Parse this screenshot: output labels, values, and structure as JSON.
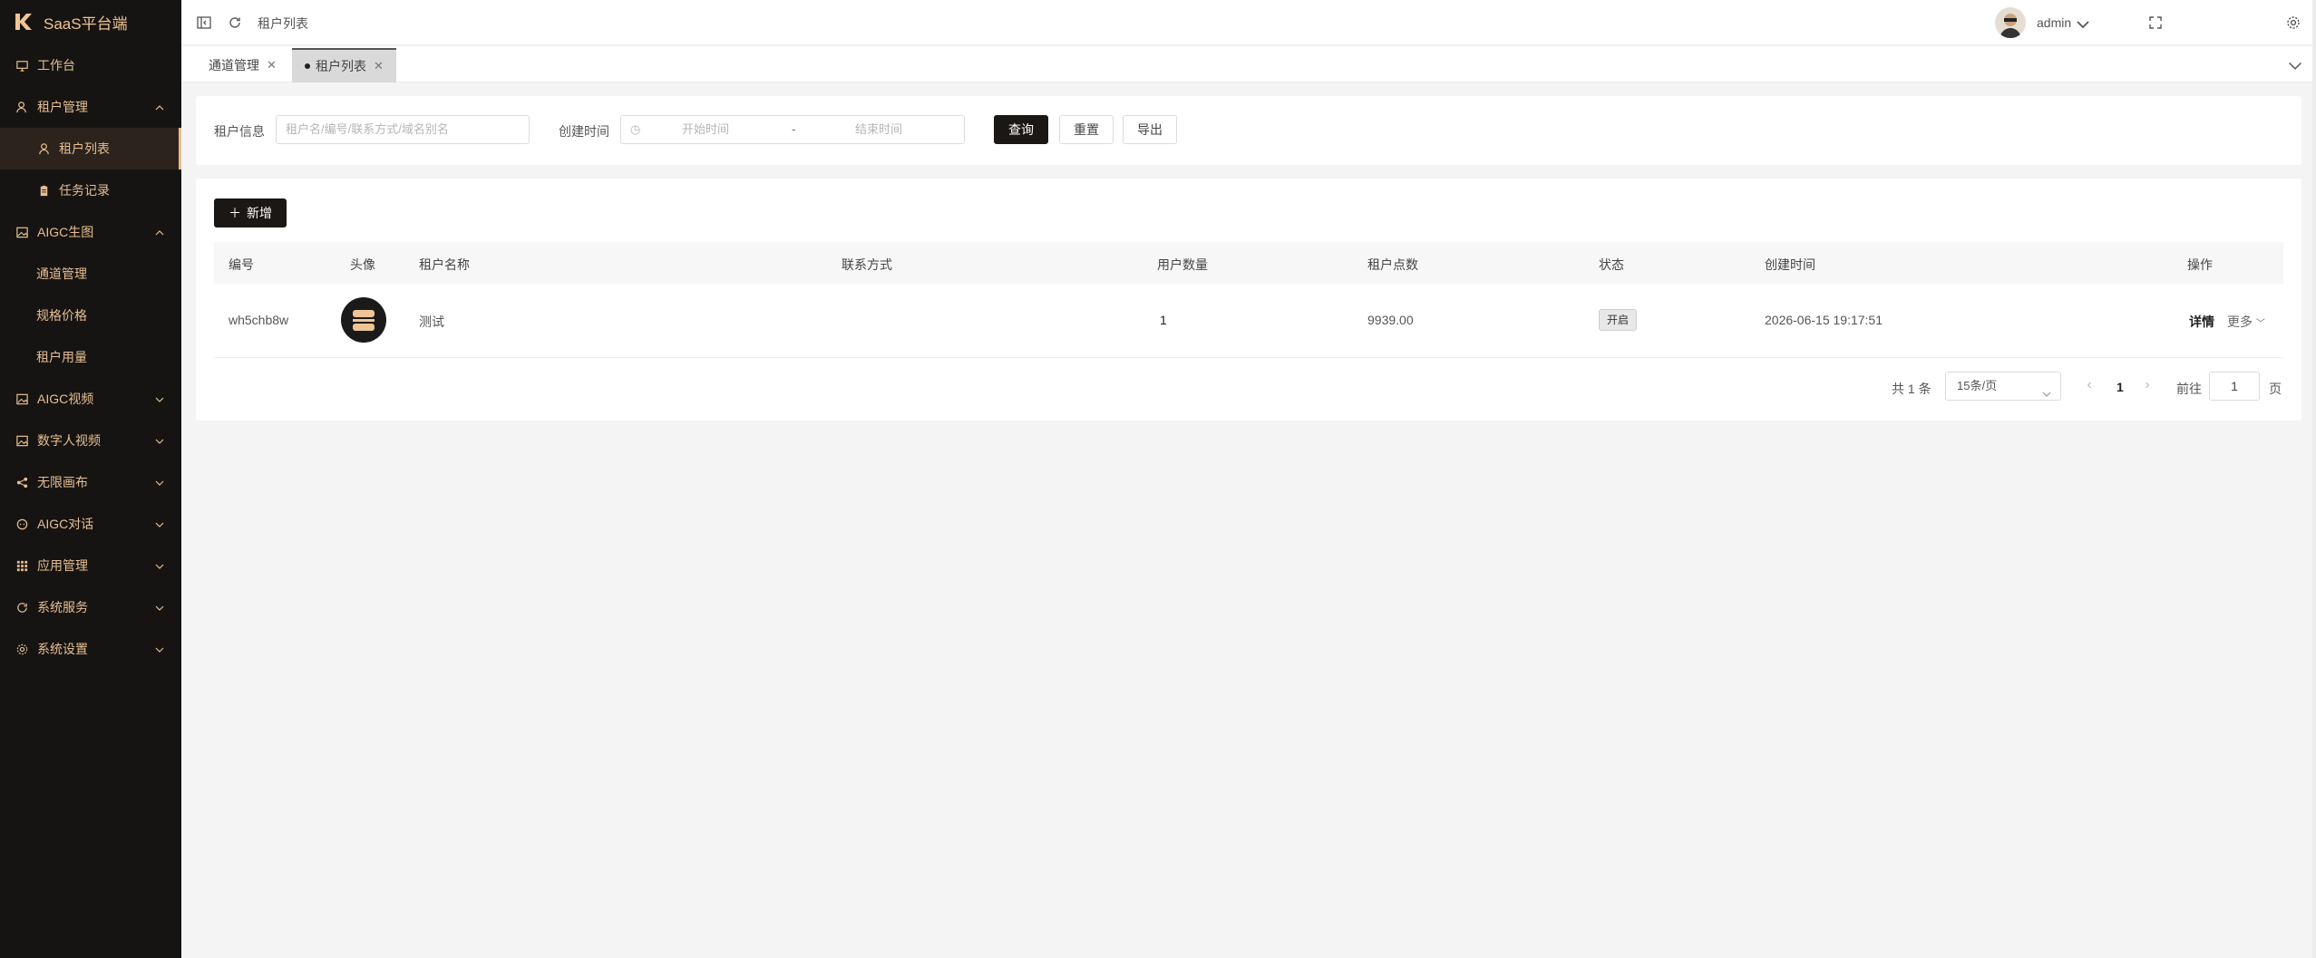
{
  "sidebar": {
    "brand": "SaaS平台端",
    "items": [
      {
        "label": "工作台"
      },
      {
        "label": "租户管理"
      },
      {
        "label": "租户列表"
      },
      {
        "label": "任务记录"
      },
      {
        "label": "AIGC生图"
      },
      {
        "label": "通道管理"
      },
      {
        "label": "规格价格"
      },
      {
        "label": "租户用量"
      },
      {
        "label": "AIGC视频"
      },
      {
        "label": "数字人视频"
      },
      {
        "label": "无限画布"
      },
      {
        "label": "AIGC对话"
      },
      {
        "label": "应用管理"
      },
      {
        "label": "系统服务"
      },
      {
        "label": "系统设置"
      }
    ]
  },
  "header": {
    "breadcrumb": "租户列表",
    "user": "admin"
  },
  "tabs": [
    {
      "label": "通道管理"
    },
    {
      "label": "租户列表"
    }
  ],
  "filter": {
    "tenant_label": "租户信息",
    "tenant_placeholder": "租户名/编号/联系方式/域名别名",
    "created_label": "创建时间",
    "start_placeholder": "开始时间",
    "range_sep": "-",
    "end_placeholder": "结束时间",
    "query": "查询",
    "reset": "重置",
    "export": "导出"
  },
  "table": {
    "add_label": "新增",
    "columns": [
      "编号",
      "头像",
      "租户名称",
      "联系方式",
      "用户数量",
      "租户点数",
      "状态",
      "创建时间",
      "操作"
    ],
    "rows": [
      {
        "id": "wh5chb8w",
        "name": "测试",
        "contact": "",
        "users": "1",
        "points": "9939.00",
        "status": "开启",
        "created": "2026-06-15 19:17:51",
        "detail": "详情",
        "more": "更多"
      }
    ]
  },
  "pagination": {
    "total": "共 1 条",
    "page_size": "15条/页",
    "current": "1",
    "goto_label": "前往",
    "goto_value": "1",
    "page_suffix": "页"
  },
  "colors": {
    "sidebar_bg": "#161412",
    "sidebar_text": "#e6be93",
    "primary_btn": "#1a1714"
  }
}
